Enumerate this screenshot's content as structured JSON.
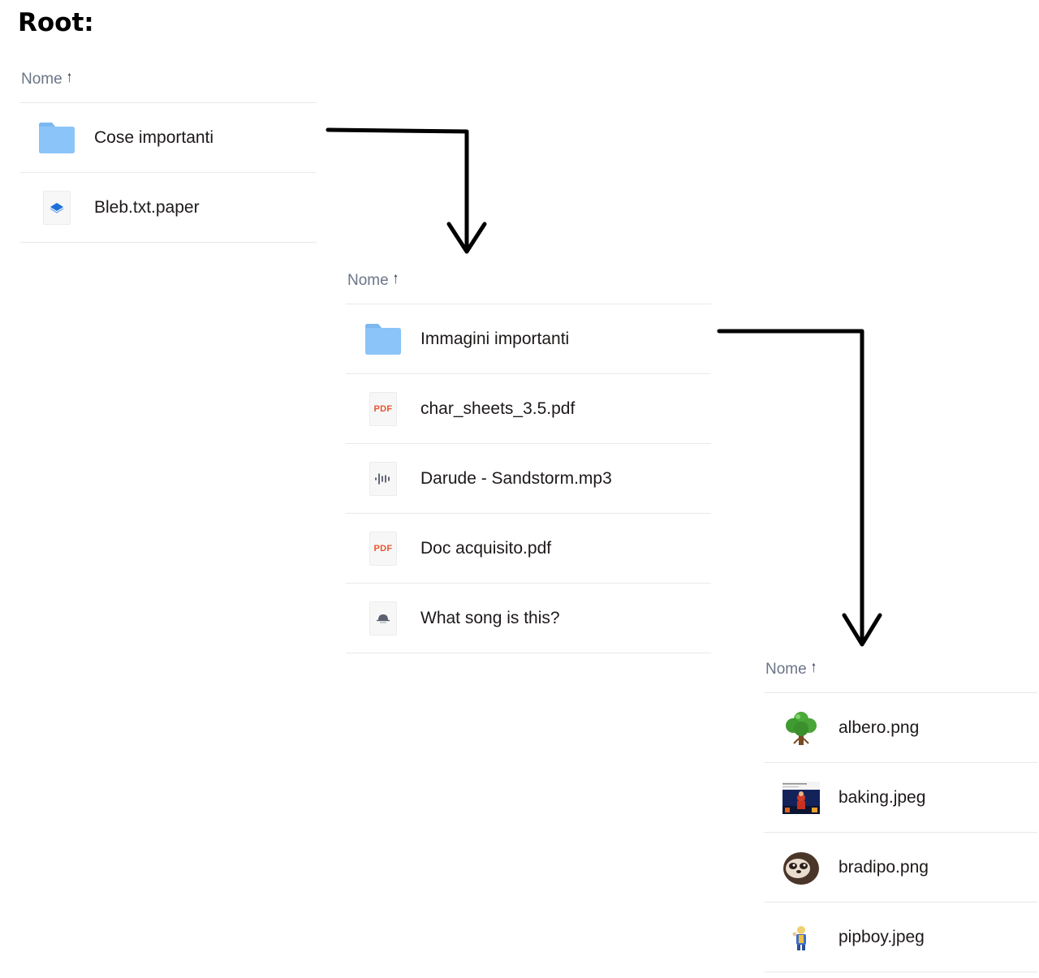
{
  "root_title": "Root:",
  "column_header": {
    "label": "Nome",
    "sort_icon": "arrow-up-icon"
  },
  "panels": [
    {
      "id": "root",
      "rows": [
        {
          "name": "Cose importanti",
          "icon": "folder-icon"
        },
        {
          "name": "Bleb.txt.paper",
          "icon": "paper-doc-icon"
        }
      ]
    },
    {
      "id": "cose-importanti",
      "rows": [
        {
          "name": "Immagini importanti",
          "icon": "folder-icon"
        },
        {
          "name": "char_sheets_3.5.pdf",
          "icon": "pdf-icon"
        },
        {
          "name": "Darude - Sandstorm.mp3",
          "icon": "audio-icon"
        },
        {
          "name": "Doc acquisito.pdf",
          "icon": "pdf-icon"
        },
        {
          "name": "What song is this?",
          "icon": "web-link-icon"
        }
      ]
    },
    {
      "id": "immagini-importanti",
      "rows": [
        {
          "name": "albero.png",
          "icon": "tree-thumbnail-icon"
        },
        {
          "name": "baking.jpeg",
          "icon": "photo-thumbnail-icon"
        },
        {
          "name": "bradipo.png",
          "icon": "sloth-thumbnail-icon"
        },
        {
          "name": "pipboy.jpeg",
          "icon": "pipboy-thumbnail-icon"
        }
      ]
    }
  ],
  "pdf_badge_text": "PDF",
  "colors": {
    "folder": "#8ac4f8",
    "folder_tab": "#7bb8f0",
    "pdf_red": "#e8542e",
    "header_text": "#6b7587",
    "divider": "#e8e9ea",
    "paper_blue": "#1e6fd9"
  }
}
